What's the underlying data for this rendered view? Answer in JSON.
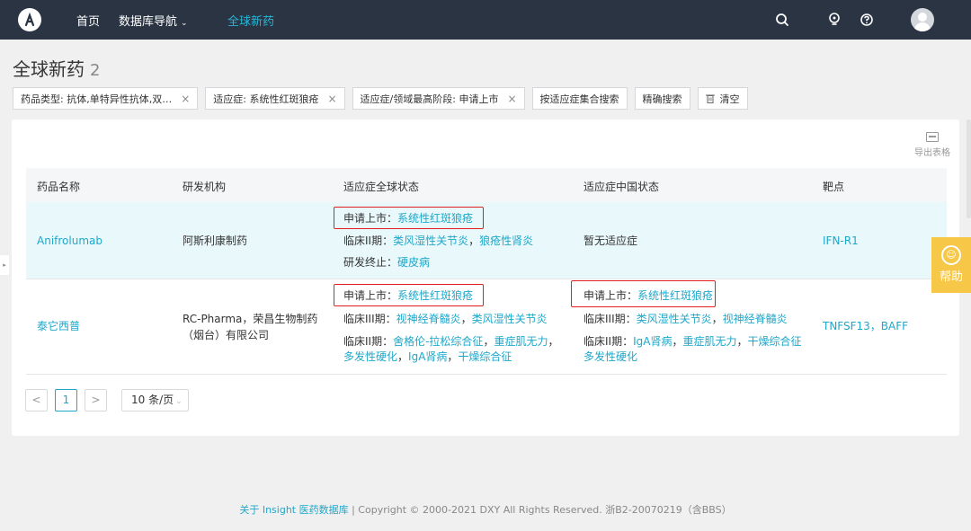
{
  "nav": {
    "home": "首页",
    "database_nav": "数据库导航",
    "caret": "⌄",
    "global_new_drugs": "全球新药"
  },
  "icons": [
    "logo",
    "search-icon",
    "bulb-icon",
    "help-circle-icon",
    "avatar-icon",
    "trash-icon",
    "export-icon",
    "help-icon"
  ],
  "page": {
    "title": "全球新药",
    "count": "2"
  },
  "filters": [
    {
      "label": "药品类型: 抗体,单特异性抗体,双…",
      "close": "×"
    },
    {
      "label": "适应症: 系统性红斑狼疮",
      "close": "×"
    },
    {
      "label": "适应症/领域最高阶段: 申请上市",
      "close": "×"
    }
  ],
  "buttons": {
    "by_indication_set": "按适应症集合搜索",
    "precise_search": "精确搜索",
    "clear": "清空",
    "export": "导出表格"
  },
  "table": {
    "headers": [
      "药品名称",
      "研发机构",
      "适应症全球状态",
      "适应症中国状态",
      "靶点"
    ],
    "rows": [
      {
        "drug": "Anifrolumab",
        "org": "阿斯利康制药",
        "global": [
          {
            "stage": "申请上市：",
            "items": [
              "系统性红斑狼疮"
            ]
          },
          {
            "stage": "临床II期：",
            "items": [
              "类风湿性关节炎",
              "狼疮性肾炎"
            ]
          },
          {
            "stage": "研发终止：",
            "items": [
              "硬皮病"
            ]
          }
        ],
        "china_text": "暂无适应症",
        "target": "IFN-R1"
      },
      {
        "drug": "泰它西普",
        "org_line1": "RC-Pharma，荣昌生物制药",
        "org_line2": "（烟台）有限公司",
        "global": [
          {
            "stage": "申请上市：",
            "items": [
              "系统性红斑狼疮"
            ]
          },
          {
            "stage": "临床III期：",
            "items": [
              "视神经脊髓炎",
              "类风湿性关节炎"
            ]
          },
          {
            "stage": "临床II期：",
            "items": [
              "舍格伦-拉松综合征",
              "重症肌无力",
              "多发性硬化",
              "IgA肾病",
              "干燥综合征"
            ]
          }
        ],
        "china": [
          {
            "stage": "申请上市：",
            "items": [
              "系统性红斑狼疮"
            ]
          },
          {
            "stage": "临床III期：",
            "items": [
              "类风湿性关节炎",
              "视神经脊髓炎"
            ]
          },
          {
            "stage": "临床II期：",
            "items": [
              "IgA肾病",
              "重症肌无力",
              "干燥综合征",
              "多发性硬化"
            ]
          }
        ],
        "target": "TNFSF13，BAFF"
      }
    ]
  },
  "pagination": {
    "prev": "<",
    "current": "1",
    "next": ">",
    "page_size": "10 条/页"
  },
  "footer": {
    "link": "关于 Insight 医药数据库",
    "copyright": " | Copyright © 2000-2021 DXY All Rights Reserved. 浙B2-20070219（含BBS）"
  },
  "help": {
    "label": "帮助",
    "icon_glyph": "☺"
  },
  "side_tab": "▸",
  "colors": {
    "topbar": "#2b3443",
    "accent": "#1fa7c9",
    "highlight_box": "#e02020",
    "help": "#f7c747",
    "row_hover": "#e9f8fb"
  }
}
